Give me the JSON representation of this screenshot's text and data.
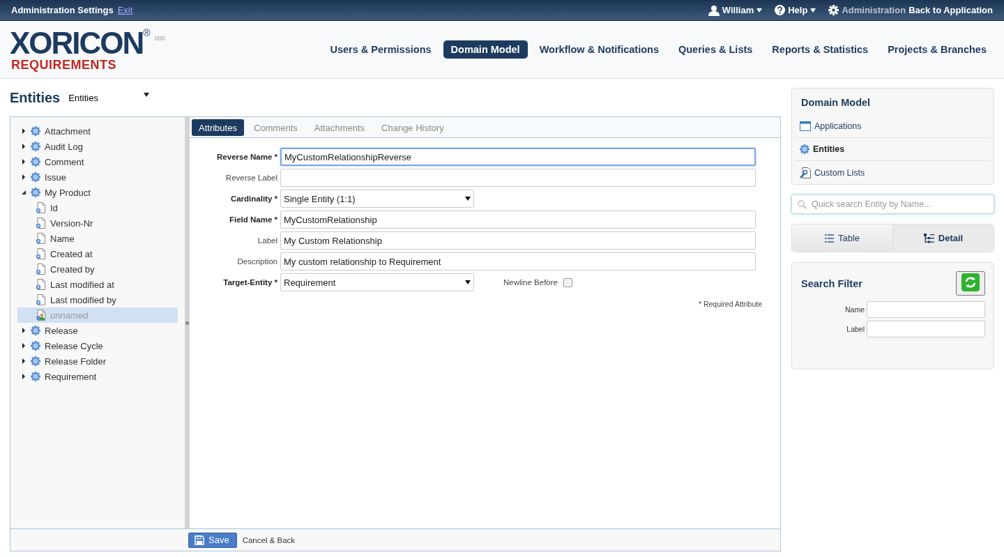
{
  "top_bar": {
    "title": "Administration Settings",
    "exit_link": "Exit",
    "user_menu": "William",
    "help_menu": "Help",
    "admin_link": "Administration",
    "back_link": "Back to Application"
  },
  "logo": {
    "word": "XORICON",
    "mark": "®",
    "sub": "REQUIREMENTS",
    "dots": "000"
  },
  "nav": [
    {
      "label": "Users & Permissions",
      "selected": false
    },
    {
      "label": "Domain Model",
      "selected": true
    },
    {
      "label": "Workflow & Notifications",
      "selected": false
    },
    {
      "label": "Queries & Lists",
      "selected": false
    },
    {
      "label": "Reports & Statistics",
      "selected": false
    },
    {
      "label": "Projects & Branches",
      "selected": false
    }
  ],
  "page_title": "Entities",
  "view_select": "Entities",
  "tree": [
    {
      "label": "Attachment",
      "kind": "entity",
      "expanded": false,
      "selected": false
    },
    {
      "label": "Audit Log",
      "kind": "entity",
      "expanded": false,
      "selected": false
    },
    {
      "label": "Comment",
      "kind": "entity",
      "expanded": false,
      "selected": false
    },
    {
      "label": "Issue",
      "kind": "entity",
      "expanded": false,
      "selected": false
    },
    {
      "label": "My Product",
      "kind": "entity",
      "expanded": true,
      "selected": false,
      "children": [
        {
          "label": "Id",
          "kind": "attribute",
          "selected": false
        },
        {
          "label": "Version-Nr",
          "kind": "attribute",
          "selected": false
        },
        {
          "label": "Name",
          "kind": "attribute",
          "selected": false
        },
        {
          "label": "Created at",
          "kind": "attribute",
          "selected": false
        },
        {
          "label": "Created by",
          "kind": "attribute",
          "selected": false
        },
        {
          "label": "Last modified at",
          "kind": "attribute",
          "selected": false
        },
        {
          "label": "Last modified by",
          "kind": "attribute",
          "selected": false
        },
        {
          "label": "unnamed",
          "kind": "relation",
          "selected": true
        }
      ]
    },
    {
      "label": "Release",
      "kind": "entity",
      "expanded": false,
      "selected": false
    },
    {
      "label": "Release Cycle",
      "kind": "entity",
      "expanded": false,
      "selected": false
    },
    {
      "label": "Release Folder",
      "kind": "entity",
      "expanded": false,
      "selected": false
    },
    {
      "label": "Requirement",
      "kind": "entity",
      "expanded": false,
      "selected": false
    }
  ],
  "tabs": [
    {
      "label": "Attributes",
      "selected": true
    },
    {
      "label": "Comments",
      "selected": false
    },
    {
      "label": "Attachments",
      "selected": false
    },
    {
      "label": "Change History",
      "selected": false
    }
  ],
  "form": [
    {
      "label": "Reverse Name *",
      "required": true,
      "kind": "input",
      "value": "MyCustomRelationshipReverse",
      "focused": true
    },
    {
      "label": "Reverse Label",
      "required": false,
      "kind": "input",
      "focused": false
    },
    {
      "label": "Cardinality *",
      "required": true,
      "kind": "select",
      "value": "Single Entity (1:1)"
    },
    {
      "label": "Field Name *",
      "required": true,
      "kind": "input",
      "value": "MyCustomRelationship",
      "focused": false
    },
    {
      "label": "Label",
      "required": false,
      "kind": "input",
      "value": "My Custom Relationship",
      "focused": false
    },
    {
      "label": "Description",
      "required": false,
      "kind": "input",
      "value": "My custom relationship to Requirement",
      "focused": false
    },
    {
      "label": "Target-Entity *",
      "required": true,
      "kind": "select",
      "value": "Requirement"
    }
  ],
  "newline_before": {
    "label": "Newline Before",
    "checked": false
  },
  "required_note": "* Required Attribute",
  "footer": {
    "save": "Save",
    "cancel": "Cancel & Back"
  },
  "sidebar": {
    "title": "Domain Model",
    "items": [
      {
        "label": "Applications",
        "kind": "window",
        "selected": false
      },
      {
        "label": "Entities",
        "kind": "entity",
        "selected": true
      },
      {
        "label": "Custom Lists",
        "kind": "list",
        "selected": false
      }
    ]
  },
  "quick_search": {
    "placeholder": "Quick search Entity by Name..."
  },
  "view_toggle": [
    {
      "label": "Table",
      "kind": "table",
      "selected": false
    },
    {
      "label": "Detail",
      "kind": "detail",
      "selected": true
    }
  ],
  "search_filter": {
    "title": "Search Filter",
    "fields": [
      {
        "label": "Name"
      },
      {
        "label": "Label"
      }
    ]
  }
}
